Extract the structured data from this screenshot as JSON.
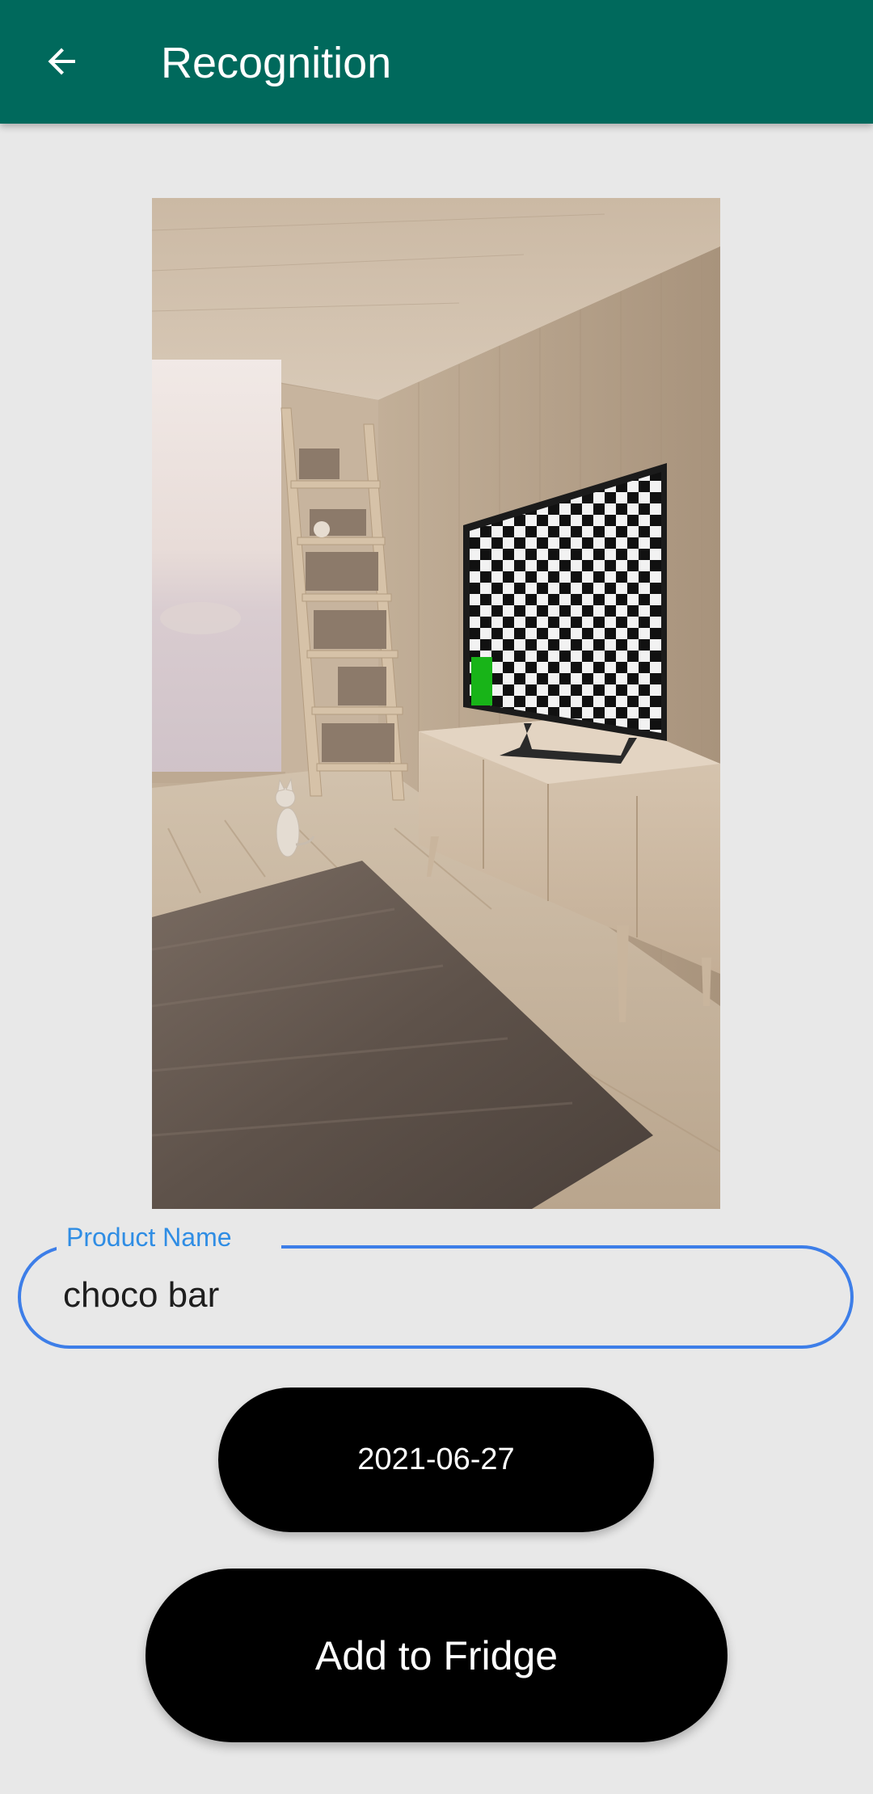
{
  "app_bar": {
    "title": "Recognition",
    "back_icon": "arrow-left-icon",
    "background_color": "#00695c"
  },
  "photo": {
    "description_icon": "room-scene-image"
  },
  "product_name_field": {
    "label": "Product Name",
    "value": "choco bar",
    "accent_color": "#3d7ee8"
  },
  "date_button": {
    "label": "2021-06-27"
  },
  "add_button": {
    "label": "Add to Fridge"
  }
}
